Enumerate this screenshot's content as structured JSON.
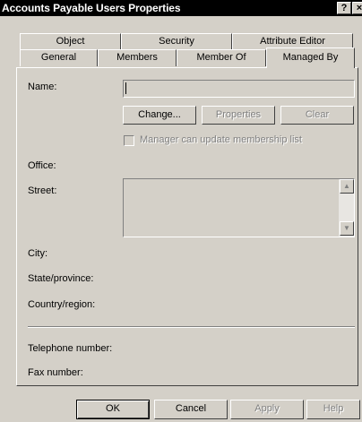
{
  "window": {
    "title": "Accounts Payable Users Properties",
    "help_button": "?",
    "close_button": "×"
  },
  "tabs": {
    "row1": [
      "Object",
      "Security",
      "Attribute Editor"
    ],
    "row2": [
      "General",
      "Members",
      "Member Of",
      "Managed By"
    ],
    "active": "Managed By"
  },
  "managed_by": {
    "name_label": "Name:",
    "name_value": "",
    "change_button": "Change...",
    "properties_button": "Properties",
    "clear_button": "Clear",
    "manager_checkbox_label": "Manager can update membership list",
    "manager_checkbox_checked": false,
    "office_label": "Office:",
    "street_label": "Street:",
    "city_label": "City:",
    "state_label": "State/province:",
    "country_label": "Country/region:",
    "telephone_label": "Telephone number:",
    "fax_label": "Fax number:"
  },
  "footer": {
    "ok": "OK",
    "cancel": "Cancel",
    "apply": "Apply",
    "help": "Help"
  }
}
